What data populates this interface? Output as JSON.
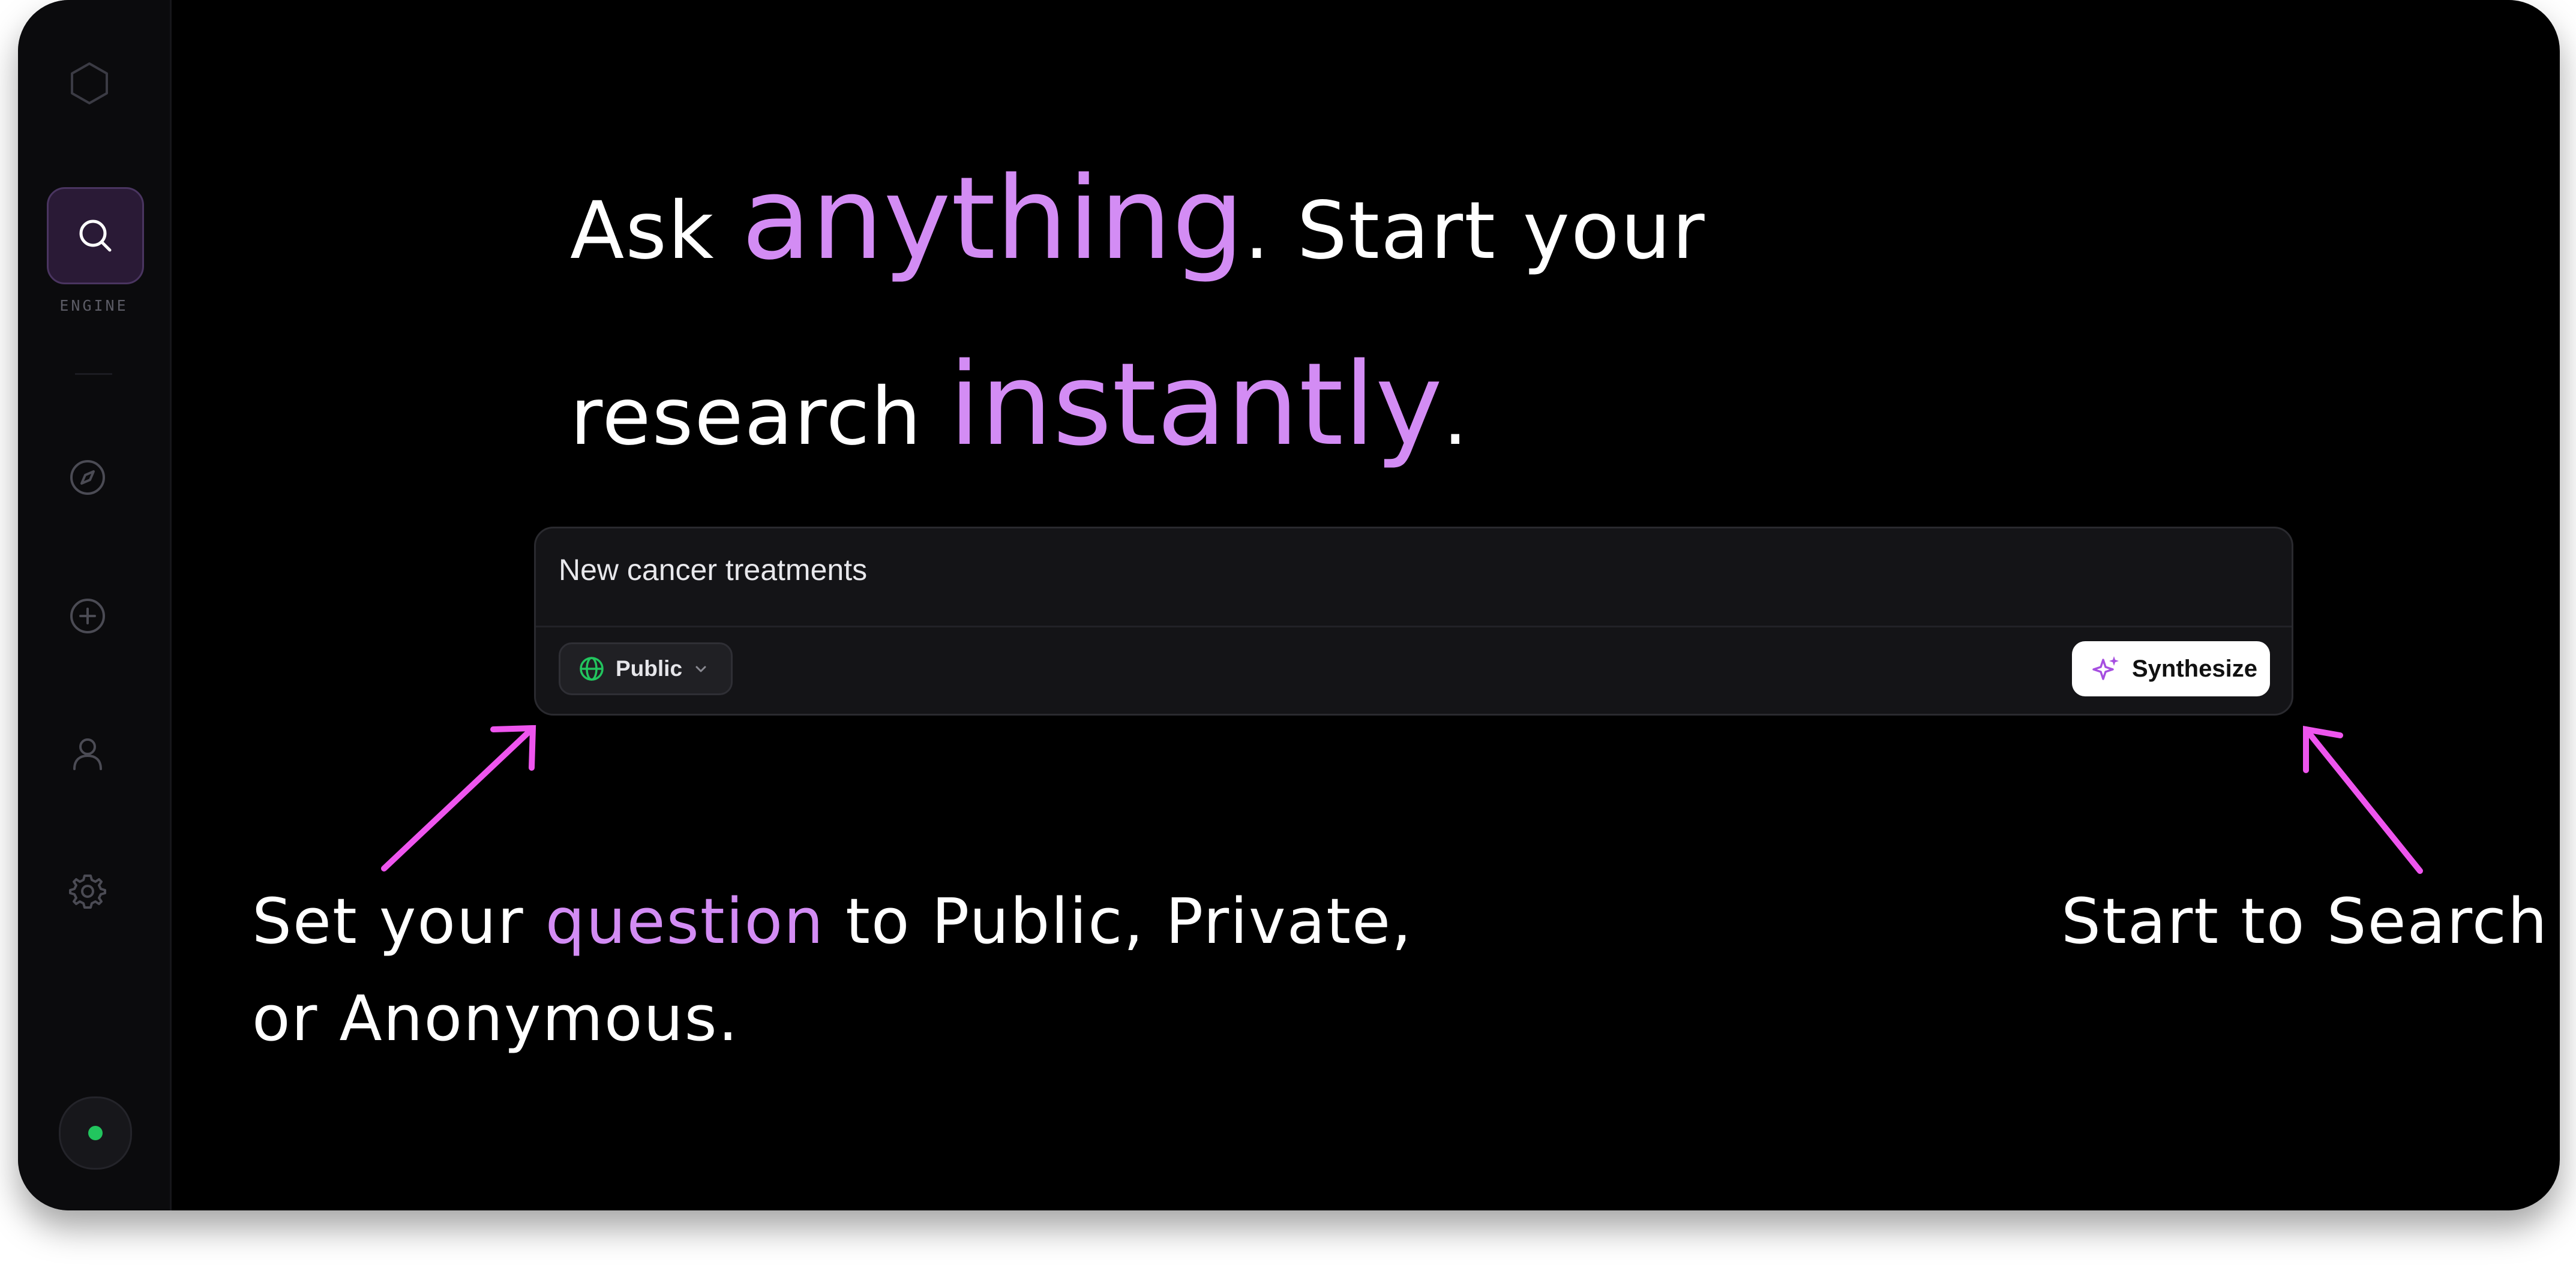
{
  "sidebar": {
    "logo_icon": "hexagon-logo-icon",
    "items": [
      {
        "icon": "search-icon",
        "label": "ENGINE",
        "active": true
      },
      {
        "icon": "compass-icon"
      },
      {
        "icon": "plus-circle-icon"
      },
      {
        "icon": "user-icon"
      },
      {
        "icon": "gear-icon"
      }
    ],
    "status_color": "#22c55e"
  },
  "headline": {
    "part1": "Ask ",
    "accent1": "anything",
    "part2": ". Start your",
    "part3": "research ",
    "accent2": "instantly",
    "part4": "."
  },
  "search": {
    "query": "New cancer treatments",
    "scope_label": "Public",
    "scope_icon": "globe-icon",
    "submit_label": "Synthesize",
    "submit_icon": "sparkles-icon"
  },
  "callouts": {
    "left_part1": "Set your ",
    "left_accent": "question",
    "left_part2": " to Public, Private,",
    "left_line2": "or Anonymous.",
    "right": "Start to Search"
  },
  "colors": {
    "accent": "#d38cf4",
    "arrow": "#ee55ee",
    "background": "#000000",
    "status": "#22c55e"
  }
}
